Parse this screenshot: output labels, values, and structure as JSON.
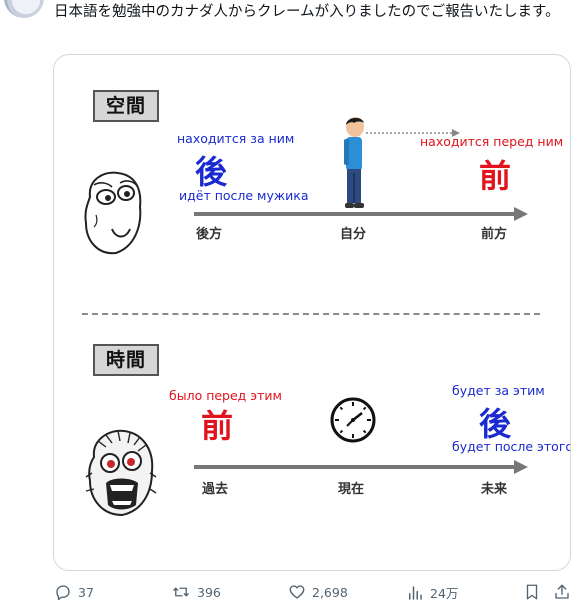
{
  "post": {
    "text": "日本語を勉強中のカナダ人からクレームが入りましたのでご報告いたします。"
  },
  "image": {
    "space_section": {
      "title": "空間",
      "behind_label_top": "находится за ним",
      "behind_kanji": "後",
      "behind_label_bottom": "идёт после мужика",
      "front_label": "находится перед ним",
      "front_kanji": "前",
      "axis_labels": [
        "後方",
        "自分",
        "前方"
      ]
    },
    "time_section": {
      "title": "時間",
      "past_label": "было перед этим",
      "past_kanji": "前",
      "future_label_top": "будет за этим",
      "future_kanji": "後",
      "future_label_bottom": "будет после этого",
      "axis_labels": [
        "過去",
        "現在",
        "未来"
      ]
    }
  },
  "actions": {
    "replies": "37",
    "reposts": "396",
    "likes": "2,698",
    "views": "24万"
  },
  "colors": {
    "blue": "#1a2ad0",
    "red": "#e1141d",
    "meta": "#536471"
  }
}
